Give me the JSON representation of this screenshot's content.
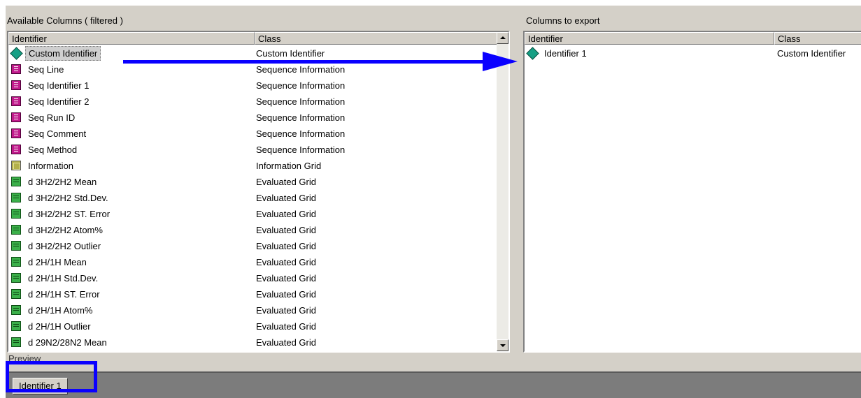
{
  "available": {
    "title": "Available Columns ( filtered )",
    "col_identifier": "Identifier",
    "col_class": "Class",
    "rows": [
      {
        "name": "Custom Identifier",
        "cls": "Custom Identifier",
        "icon": "custom-identifier-icon"
      },
      {
        "name": "Seq Line",
        "cls": "Sequence Information",
        "icon": "sequence-info-icon"
      },
      {
        "name": "Seq Identifier 1",
        "cls": "Sequence Information",
        "icon": "sequence-info-icon"
      },
      {
        "name": "Seq Identifier 2",
        "cls": "Sequence Information",
        "icon": "sequence-info-icon"
      },
      {
        "name": "Seq Run ID",
        "cls": "Sequence Information",
        "icon": "sequence-info-icon"
      },
      {
        "name": "Seq Comment",
        "cls": "Sequence Information",
        "icon": "sequence-info-icon"
      },
      {
        "name": "Seq Method",
        "cls": "Sequence Information",
        "icon": "sequence-info-icon"
      },
      {
        "name": "Information",
        "cls": "Information Grid",
        "icon": "information-grid-icon"
      },
      {
        "name": "d  3H2/2H2  Mean",
        "cls": "Evaluated Grid",
        "icon": "evaluated-grid-icon"
      },
      {
        "name": "d  3H2/2H2  Std.Dev.",
        "cls": "Evaluated Grid",
        "icon": "evaluated-grid-icon"
      },
      {
        "name": "d  3H2/2H2  ST. Error",
        "cls": "Evaluated Grid",
        "icon": "evaluated-grid-icon"
      },
      {
        "name": "d  3H2/2H2 Atom%",
        "cls": "Evaluated Grid",
        "icon": "evaluated-grid-icon"
      },
      {
        "name": "d  3H2/2H2 Outlier",
        "cls": "Evaluated Grid",
        "icon": "evaluated-grid-icon"
      },
      {
        "name": "d  2H/1H  Mean",
        "cls": "Evaluated Grid",
        "icon": "evaluated-grid-icon"
      },
      {
        "name": "d  2H/1H  Std.Dev.",
        "cls": "Evaluated Grid",
        "icon": "evaluated-grid-icon"
      },
      {
        "name": "d  2H/1H  ST. Error",
        "cls": "Evaluated Grid",
        "icon": "evaluated-grid-icon"
      },
      {
        "name": "d  2H/1H Atom%",
        "cls": "Evaluated Grid",
        "icon": "evaluated-grid-icon"
      },
      {
        "name": "d  2H/1H Outlier",
        "cls": "Evaluated Grid",
        "icon": "evaluated-grid-icon"
      },
      {
        "name": "d  29N2/28N2  Mean",
        "cls": "Evaluated Grid",
        "icon": "evaluated-grid-icon"
      }
    ]
  },
  "export": {
    "title": "Columns to export",
    "col_identifier": "Identifier",
    "col_class": "Class",
    "rows": [
      {
        "name": "Identifier 1",
        "cls": "Custom Identifier",
        "icon": "custom-identifier-icon"
      }
    ]
  },
  "preview": {
    "label": "Preview",
    "tag": "Identifier 1"
  },
  "colors": {
    "annotation": "#0a00ff",
    "dialog_bg": "#d4d0c8"
  }
}
